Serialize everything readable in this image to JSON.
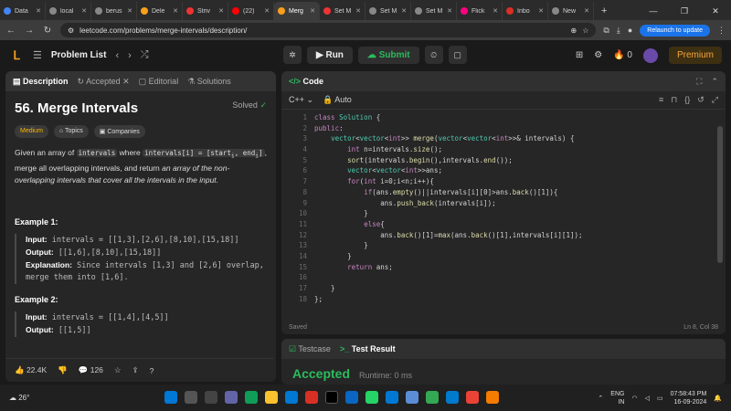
{
  "browser": {
    "tabs": [
      "Data",
      "local",
      "berus",
      "Dele",
      "Striv",
      "(22)",
      "Merg",
      "Set M",
      "Set M",
      "Set M",
      "Flick",
      "Inbo",
      "New"
    ],
    "active_tab_index": 6,
    "url": "leetcode.com/problems/merge-intervals/description/",
    "relaunch_label": "Relaunch to update"
  },
  "header": {
    "problem_list_label": "Problem List",
    "run_label": "Run",
    "submit_label": "Submit",
    "streak": "0",
    "premium_label": "Premium"
  },
  "left_tabs": {
    "description": "Description",
    "accepted": "Accepted",
    "editorial": "Editorial",
    "solutions": "Solutions"
  },
  "problem": {
    "title": "56. Merge Intervals",
    "status": "Solved",
    "difficulty": "Medium",
    "topics_label": "Topics",
    "companies_label": "Companies",
    "desc_1": "Given an array of",
    "code_intervals": "intervals",
    "desc_2": "where",
    "code_def": "intervals[i] = [start",
    "desc_3": ", merge all overlapping intervals, and return",
    "desc_em": "an array of the non-overlapping intervals that cover all the intervals in the input.",
    "example1_label": "Example 1:",
    "ex1_input_lbl": "Input:",
    "ex1_input": "intervals = [[1,3],[2,6],[8,10],[15,18]]",
    "ex1_output_lbl": "Output:",
    "ex1_output": "[[1,6],[8,10],[15,18]]",
    "ex1_expl_lbl": "Explanation:",
    "ex1_expl": "Since intervals [1,3] and [2,6] overlap, merge them into [1,6].",
    "example2_label": "Example 2:",
    "ex2_input_lbl": "Input:",
    "ex2_input": "intervals = [[1,4],[4,5]]",
    "ex2_output_lbl": "Output:",
    "ex2_output": "[[1,5]]"
  },
  "footer": {
    "likes": "22.4K",
    "comments": "126"
  },
  "code_panel": {
    "title": "Code",
    "language": "C++",
    "auto_label": "Auto",
    "saved_label": "Saved",
    "cursor_pos": "Ln 8, Col 38"
  },
  "code_lines": [
    "class Solution {",
    "public:",
    "    vector<vector<int>> merge(vector<vector<int>>& intervals) {",
    "        int n=intervals.size();",
    "        sort(intervals.begin(),intervals.end());",
    "        vector<vector<int>>ans;",
    "        for(int i=0;i<n;i++){",
    "            if(ans.empty()||intervals[i][0]>ans.back()[1]){",
    "                ans.push_back(intervals[i]);",
    "            }",
    "            else{",
    "                ans.back()[1]=max(ans.back()[1],intervals[i][1]);",
    "            }",
    "        }",
    "        return ans;",
    "",
    "    }",
    "};"
  ],
  "test_panel": {
    "testcase_label": "Testcase",
    "result_label": "Test Result",
    "verdict": "Accepted",
    "runtime": "Runtime: 0 ms"
  },
  "taskbar": {
    "weather": "26°",
    "lang": "ENG",
    "region": "IN",
    "time": "07:58:43 PM",
    "date": "16-09-2024"
  }
}
